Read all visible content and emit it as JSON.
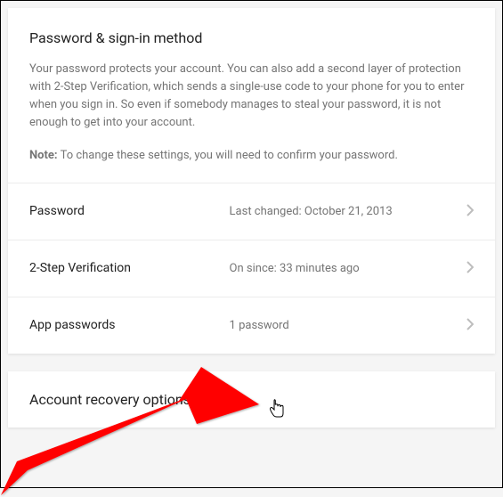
{
  "section": {
    "title": "Password & sign-in method",
    "description": "Your password protects your account. You can also add a second layer of protection with 2-Step Verification, which sends a single-use code to your phone for you to enter when you sign in. So even if somebody manages to steal your password, it is not enough to get into your account.",
    "note_label": "Note:",
    "note_text": " To change these settings, you will need to confirm your password."
  },
  "rows": {
    "password": {
      "label": "Password",
      "status": "Last changed: October 21, 2013"
    },
    "two_step": {
      "label": "2-Step Verification",
      "status": "On since: 33 minutes ago"
    },
    "app_passwords": {
      "label": "App passwords",
      "status": "1 password"
    }
  },
  "next_section": {
    "title": "Account recovery options"
  }
}
